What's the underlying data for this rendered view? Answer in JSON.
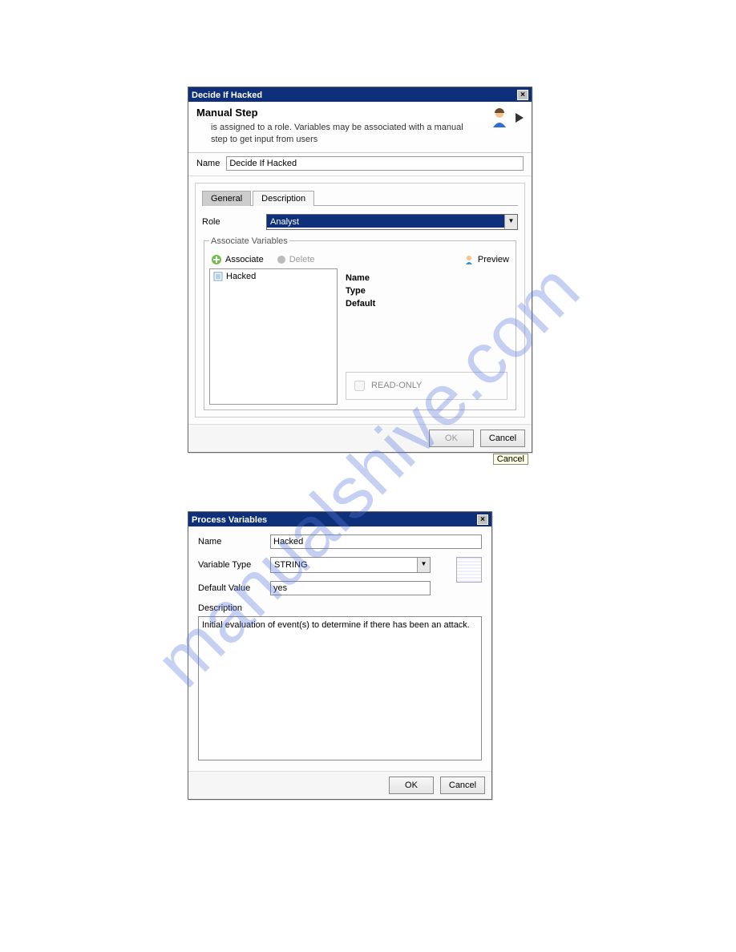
{
  "watermark": "manualshive.com",
  "dialog1": {
    "title": "Decide If Hacked",
    "header_title": "Manual Step",
    "header_desc": "is assigned to a role. Variables may be associated with a manual step to get input from users",
    "name_label": "Name",
    "name_value": "Decide If Hacked",
    "tabs": {
      "general": "General",
      "description": "Description"
    },
    "role_label": "Role",
    "role_value": "Analyst",
    "fieldset_legend": "Associate Variables",
    "toolbar": {
      "associate": "Associate",
      "delete": "Delete",
      "preview": "Preview"
    },
    "list_item": "Hacked",
    "details": {
      "name_label": "Name",
      "type_label": "Type",
      "default_label": "Default"
    },
    "readonly_label": "READ-ONLY",
    "ok": "OK",
    "cancel": "Cancel",
    "cancel_tooltip": "Cancel"
  },
  "dialog2": {
    "title": "Process Variables",
    "name_label": "Name",
    "name_value": "Hacked",
    "type_label": "Variable Type",
    "type_value": "STRING",
    "default_label": "Default Value",
    "default_value": "yes",
    "desc_label": "Description",
    "desc_value": "Initial evaluation of event(s) to determine if there has been an attack.",
    "ok": "OK",
    "cancel": "Cancel"
  }
}
